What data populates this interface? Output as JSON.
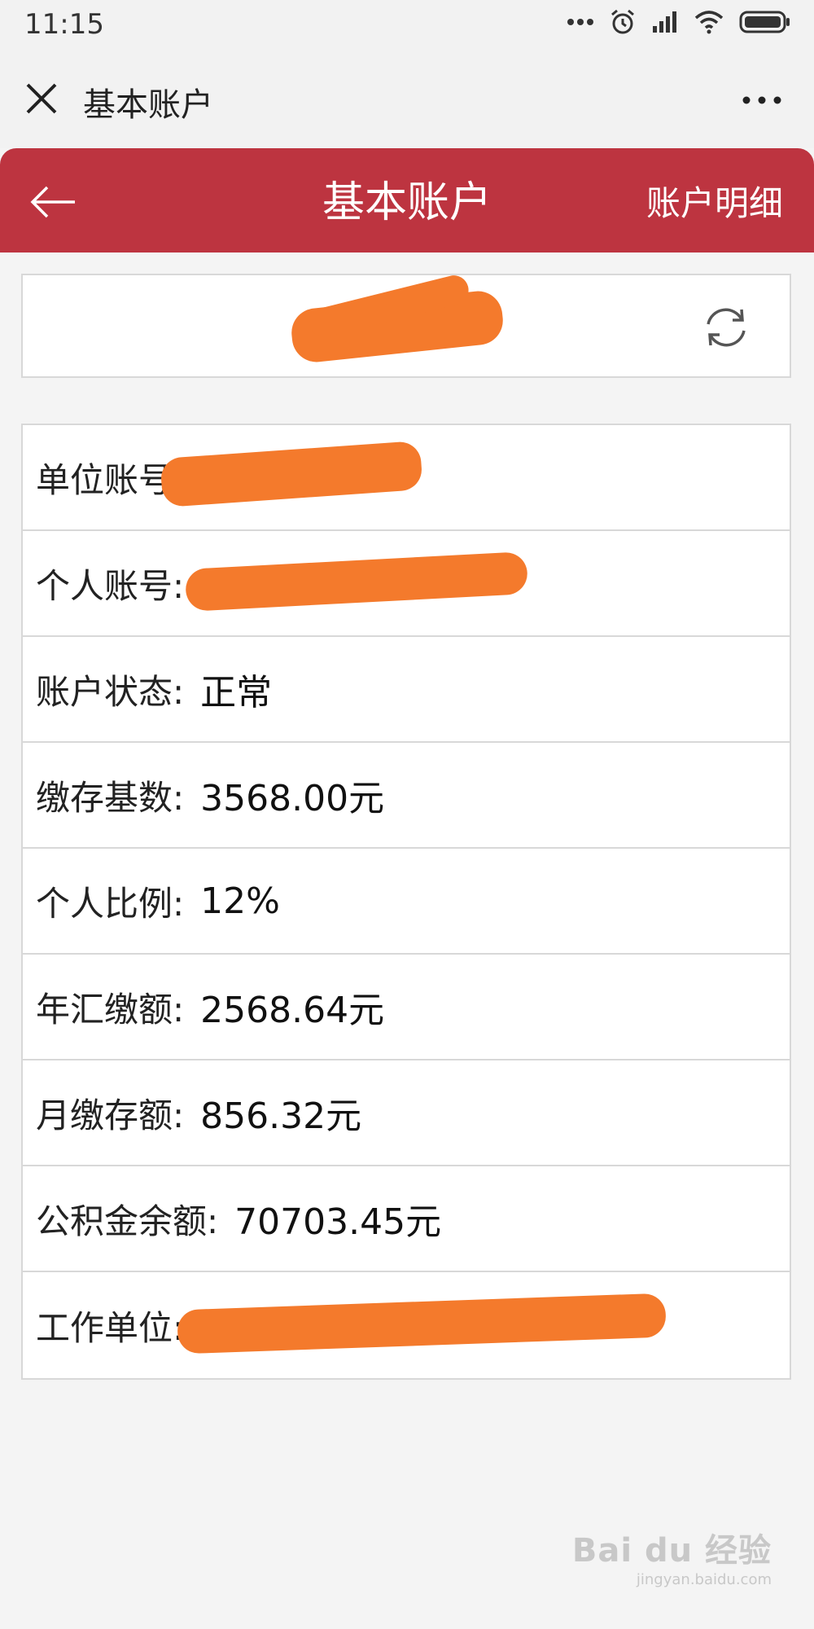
{
  "status_bar": {
    "time": "11:15",
    "icons": [
      "more-dots-icon",
      "alarm-icon",
      "signal-icon",
      "wifi-icon",
      "battery-icon"
    ]
  },
  "top_bar": {
    "title": "基本账户",
    "close_icon": "close-icon",
    "more_icon": "more-icon"
  },
  "header": {
    "title": "基本账户",
    "detail_link": "账户明细",
    "back_icon": "back-arrow-icon",
    "background_color": "#bd3440"
  },
  "name_card": {
    "refresh_icon": "refresh-icon"
  },
  "info_rows": [
    {
      "label": "单位账号:",
      "value": ""
    },
    {
      "label": "个人账号:",
      "value": ""
    },
    {
      "label": "账户状态:",
      "value": "正常"
    },
    {
      "label": "缴存基数:",
      "value": "3568.00元"
    },
    {
      "label": "个人比例:",
      "value": "12%"
    },
    {
      "label": "年汇缴额:",
      "value": "2568.64元"
    },
    {
      "label": "月缴存额:",
      "value": "856.32元"
    },
    {
      "label": "公积金余额:",
      "value": "70703.45元"
    },
    {
      "label": "工作单位:",
      "value": ""
    }
  ],
  "watermark": {
    "main": "Bai du 经验",
    "sub": "jingyan.baidu.com"
  }
}
